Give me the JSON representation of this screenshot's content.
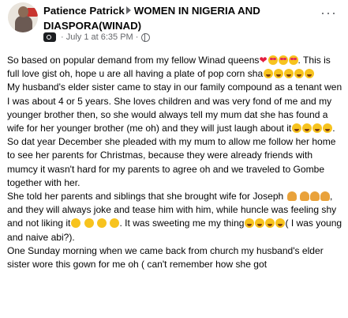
{
  "post": {
    "author": "Patience Patrick",
    "group": "WOMEN IN NIGERIA AND DIASPORA(WINAD)",
    "timestamp": "July 1 at 6:35 PM",
    "dot_separator": "·",
    "more_label": "···"
  },
  "body": {
    "p1a": "So based on popular demand from my fellow Winad queens",
    "p1b": ". This is full love gist oh, hope u are all having a plate of pop corn sha",
    "p2a": "My husband's elder sister came to stay in our family compound as a tenant wen I was about 4 or 5 years. She loves children and was very fond of me and my younger brother then, so she would always tell my mum dat she has found a wife for her younger brother (me oh) and they will just laugh about it",
    "p2b": ". So dat year December she pleaded with my mum to allow me follow her home to see her parents for Christmas, because they were already friends with mumcy it wasn't hard for my parents to agree oh and we traveled to Gombe together with her.",
    "p3a": "She told her parents and siblings that she brought wife for Joseph",
    "p3b": ", and they will always joke and tease him with him, while huncle was feeling shy and not liking it",
    "p3c": ". It was sweeting me my thing",
    "p3d": "( I was young and naive abi?).",
    "p4": "One Sunday morning when we came back from church my husband's elder sister wore this gown for me oh ( can't remember how she got"
  },
  "icons": {
    "heart": "❤",
    "group_badge": "group-badge-icon",
    "privacy": "globe-icon"
  },
  "colors": {
    "secondary_text": "#65676b",
    "heart": "#e41e3f"
  }
}
